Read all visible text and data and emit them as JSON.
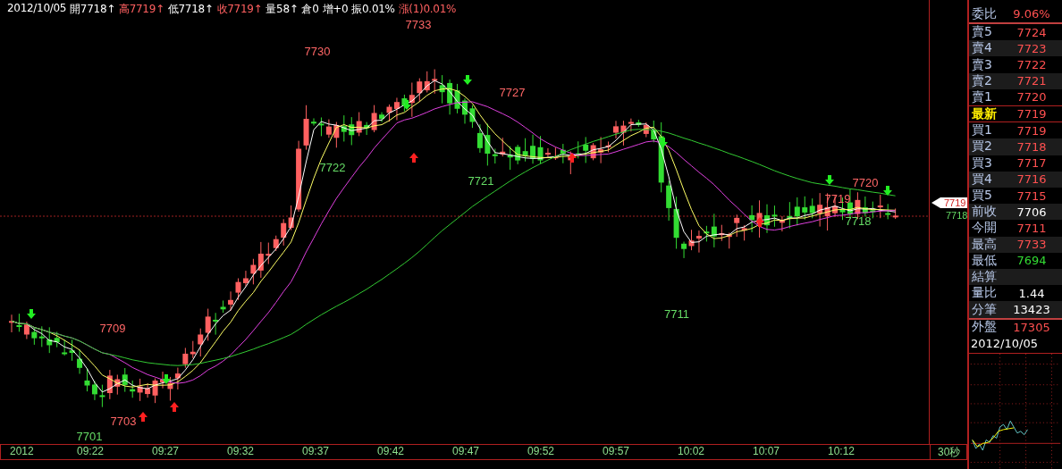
{
  "info_bar": [
    {
      "text": "2012/10/05",
      "color": "#ffffff"
    },
    {
      "text": "開7718↑",
      "color": "#ffffff"
    },
    {
      "text": "高7719↑",
      "color": "#ff6060"
    },
    {
      "text": "低7718↑",
      "color": "#ffffff"
    },
    {
      "text": "收7719↑",
      "color": "#ff6060"
    },
    {
      "text": "量58↑",
      "color": "#ffffff"
    },
    {
      "text": "倉0",
      "color": "#ffffff"
    },
    {
      "text": "增+0",
      "color": "#ffffff"
    },
    {
      "text": "振0.01%",
      "color": "#ffffff"
    },
    {
      "text": "漲(1)0.01%",
      "color": "#ff6060"
    }
  ],
  "chart": {
    "price_labels": [
      {
        "text": "7733",
        "color": "#ff6666"
      },
      {
        "text": "7730",
        "color": "#ff6666"
      },
      {
        "text": "7727",
        "color": "#ff6666"
      },
      {
        "text": "7722",
        "color": "#66dd66"
      },
      {
        "text": "7721",
        "color": "#66dd66"
      },
      {
        "text": "7711",
        "color": "#66dd66"
      },
      {
        "text": "7709",
        "color": "#ff6666"
      },
      {
        "text": "7703",
        "color": "#ff6666"
      },
      {
        "text": "7701",
        "color": "#66dd66"
      },
      {
        "text": "7720",
        "color": "#ff6666"
      },
      {
        "text": "7719",
        "color": "#ff6666"
      },
      {
        "text": "7718",
        "color": "#66dd66"
      }
    ]
  },
  "price_axis": {
    "last_price": "7719",
    "prev_price": "7718"
  },
  "time_axis": {
    "labels": [
      "2012",
      "09:22",
      "09:27",
      "09:32",
      "09:37",
      "09:42",
      "09:47",
      "09:52",
      "09:57",
      "10:02",
      "10:07",
      "10:12"
    ],
    "interval": "30秒"
  },
  "quote_panel": {
    "header": {
      "label": "委比",
      "value": "9.06%"
    },
    "rows": [
      {
        "label": "賣5",
        "value": "7724",
        "color": "#ff5050",
        "kind": "normal"
      },
      {
        "label": "賣4",
        "value": "7723",
        "color": "#ff5050",
        "kind": "normal"
      },
      {
        "label": "賣3",
        "value": "7722",
        "color": "#ff5050",
        "kind": "normal"
      },
      {
        "label": "賣2",
        "value": "7721",
        "color": "#ff5050",
        "kind": "normal"
      },
      {
        "label": "賣1",
        "value": "7720",
        "color": "#ff5050",
        "kind": "normal"
      },
      {
        "label": "最新",
        "value": "7719",
        "color": "#ff5050",
        "kind": "latest"
      },
      {
        "label": "買1",
        "value": "7719",
        "color": "#ff5050",
        "kind": "normal"
      },
      {
        "label": "買2",
        "value": "7718",
        "color": "#ff5050",
        "kind": "normal"
      },
      {
        "label": "買3",
        "value": "7717",
        "color": "#ff5050",
        "kind": "normal"
      },
      {
        "label": "買4",
        "value": "7716",
        "color": "#ff5050",
        "kind": "normal"
      },
      {
        "label": "買5",
        "value": "7715",
        "color": "#ff5050",
        "kind": "normal"
      },
      {
        "label": "前收",
        "value": "7706",
        "color": "#ffffff",
        "kind": "normal"
      },
      {
        "label": "今開",
        "value": "7711",
        "color": "#ff5050",
        "kind": "normal"
      },
      {
        "label": "最高",
        "value": "7733",
        "color": "#ff5050",
        "kind": "normal"
      },
      {
        "label": "最低",
        "value": "7694",
        "color": "#33dd33",
        "kind": "normal"
      },
      {
        "label": "結算",
        "kind": "normal"
      },
      {
        "label": "量比",
        "value": "1.44",
        "color": "#ffffff",
        "kind": "normal"
      },
      {
        "label": "分筆",
        "value": "13423",
        "color": "#ffffff",
        "kind": "normal"
      },
      {
        "label": "外盤",
        "value": "17305",
        "color": "#ff5050",
        "kind": "total"
      }
    ],
    "date": "2012/10/05"
  }
}
